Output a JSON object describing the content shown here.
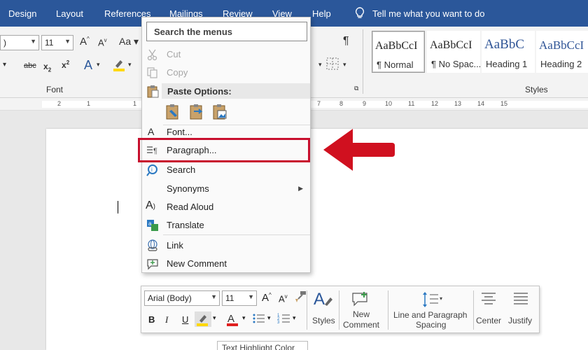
{
  "menubar": {
    "tabs": [
      "Design",
      "Layout",
      "References",
      "Mailings",
      "Review",
      "View",
      "Help"
    ],
    "tell_me": "Tell me what you want to do"
  },
  "ribbon": {
    "font_name_value": ")",
    "font_size_value": "11",
    "group_font_label": "Font",
    "group_styles_label": "Styles",
    "styles": [
      {
        "preview": "AaBbCcI",
        "name": "¶ Normal"
      },
      {
        "preview": "AaBbCcI",
        "name": "¶ No Spac..."
      },
      {
        "preview": "AaBbC",
        "name": "Heading 1"
      },
      {
        "preview": "AaBbCcI",
        "name": "Heading 2"
      }
    ]
  },
  "ruler": {
    "numbers": [
      "2",
      "1",
      "1",
      "7",
      "8",
      "9",
      "10",
      "11",
      "12",
      "13",
      "14",
      "15"
    ]
  },
  "context_menu": {
    "search_placeholder": "Search the menus",
    "items": {
      "cut": "Cut",
      "copy": "Copy",
      "paste_options": "Paste Options:",
      "font": "Font...",
      "paragraph": "Paragraph...",
      "search": "Search",
      "synonyms": "Synonyms",
      "read_aloud": "Read Aloud",
      "translate": "Translate",
      "link": "Link",
      "new_comment": "New Comment"
    }
  },
  "mini_toolbar": {
    "font_name": "Arial (Body)",
    "font_size": "11",
    "styles_label": "Styles",
    "new_comment_label_1": "New",
    "new_comment_label_2": "Comment",
    "line_spacing_label_1": "Line and Paragraph",
    "line_spacing_label_2": "Spacing",
    "center_label": "Center",
    "justify_label": "Justify"
  },
  "tooltip": "Text Highlight Color",
  "colors": {
    "menubar_bg": "#2b579a",
    "highlight_red": "#c8102e",
    "heading_blue": "#2f5496"
  }
}
